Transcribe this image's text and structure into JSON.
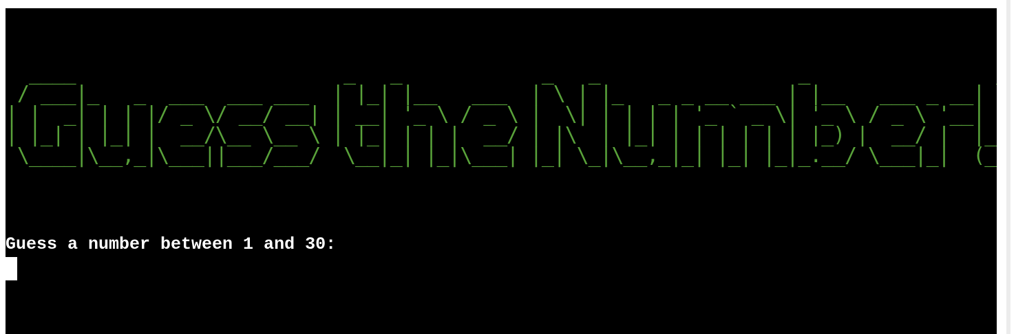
{
  "terminal": {
    "banner_lines": [
      "  ____                       _   _            _   _                 _                _ ",
      " / ___|_   _  ___  ___ ___  | |_| |__   ___  | \\ | |_   _ _ __ ___ | |__   ___ _ __| |",
      "| |  _| | | |/ _ \\/ __/ __| | __| '_ \\ / _ \\ |  \\| | | | | '_ ` _ \\| '_ \\ / _ \\ '__| |",
      "| |_| | |_| |  __/\\__ \\__ \\ | |_| | | |  __/ | |\\  | |_| | | | | | | |_) |  __/ |  |_|",
      " \\____|\\__,_|\\___||___/___/  \\__|_| |_|\\___| |_| \\_|\\__,_|_| |_| |_|_.__/ \\___|_|  (_)"
    ],
    "prompt": "Guess a number between 1 and 30:",
    "colors": {
      "background": "#000000",
      "banner": "#59a23a",
      "prompt": "#ffffff",
      "cursor": "#ffffff"
    }
  }
}
